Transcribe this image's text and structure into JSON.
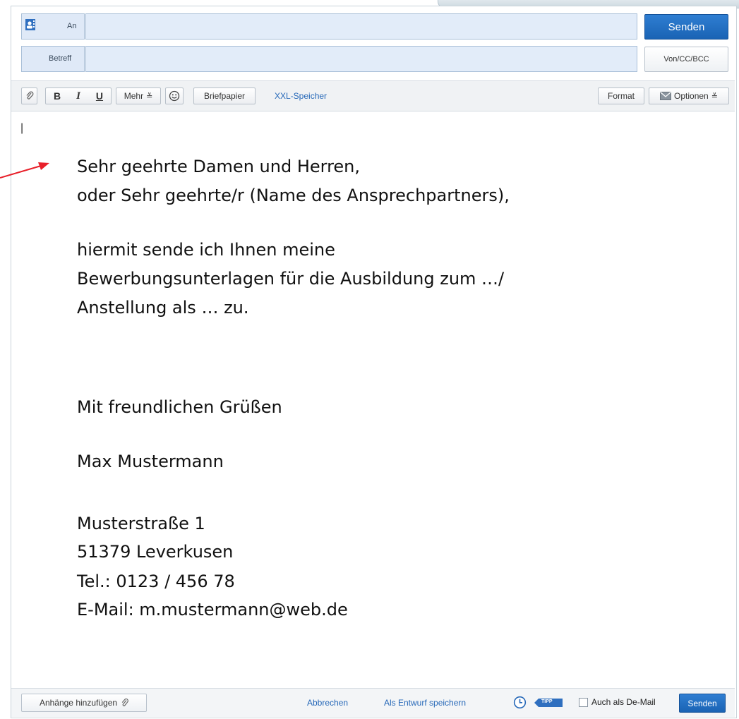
{
  "header": {
    "to_label": "An",
    "to_value": "",
    "send_label": "Senden",
    "subject_label": "Betreff",
    "subject_value": "",
    "von_cc_bcc_label": "Von/CC/BCC"
  },
  "toolbar": {
    "bold": "B",
    "italic": "I",
    "underline": "U",
    "mehr": "Mehr",
    "briefpapier": "Briefpapier",
    "xxl_speicher": "XXL-Speicher",
    "format": "Format",
    "optionen": "Optionen"
  },
  "editor": {
    "cursor": "|",
    "lines": {
      "l1": "Sehr geehrte Damen und Herren,",
      "l2": "oder Sehr geehrte/r (Name des Ansprechpartners),",
      "l3": "hiermit sende ich Ihnen meine",
      "l4": "Bewerbungsunterlagen für die Ausbildung zum …/",
      "l5": "Anstellung als … zu.",
      "l6": "Mit freundlichen Grüßen",
      "l7": "Max Mustermann",
      "l8": "Musterstraße 1",
      "l9": "51379 Leverkusen",
      "l10": "Tel.: 0123 / 456 78",
      "l11": "E-Mail: m.mustermann@web.de"
    }
  },
  "footer": {
    "attach_label": "Anhänge hinzufügen",
    "abbrechen": "Abbrechen",
    "entwurf": "Als Entwurf speichern",
    "tipp": "TIPP",
    "de_mail_label": "Auch als De-Mail",
    "send_label": "Senden"
  },
  "colors": {
    "accent": "#1a63b4",
    "field_bg": "#e2ecf9",
    "link": "#2668b8",
    "annotation_arrow": "#e8202a"
  },
  "icons": {
    "contacts": "address-book-icon",
    "attach": "paperclip-icon",
    "emoji": "smiley-icon",
    "options": "envelope-icon",
    "more": "double-chevron-icon",
    "clock": "clock-icon"
  }
}
